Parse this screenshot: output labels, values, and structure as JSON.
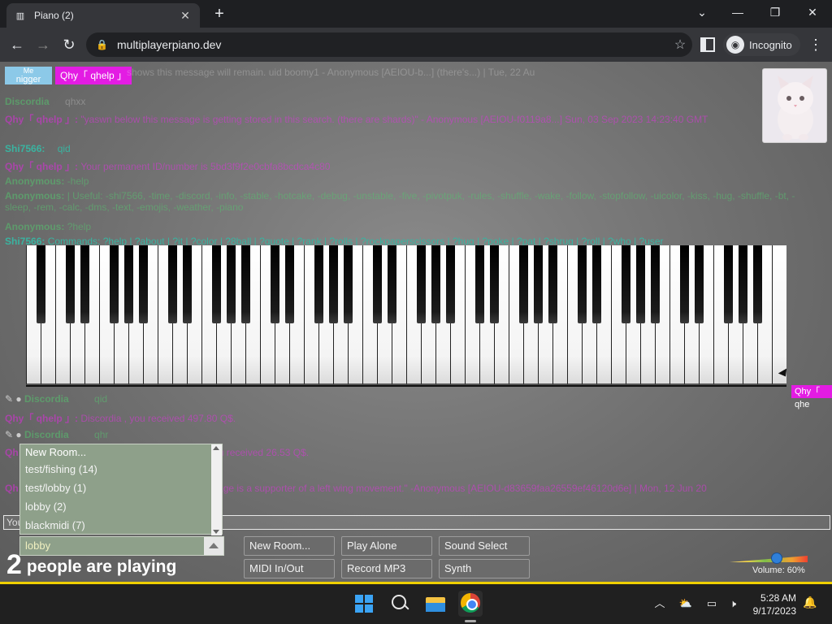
{
  "browser": {
    "tab_title": "Piano (2)",
    "tab_close": "✕",
    "new_tab": "+",
    "url": "multiplayerpiano.dev",
    "incognito_label": "Incognito",
    "window_minimize": "—",
    "window_restore": "❐",
    "window_close": "✕",
    "dropdown": "⌄"
  },
  "users": {
    "me_label": "Me",
    "me_name": "nigger",
    "other": "Qhy「 qhelp 」"
  },
  "chat": {
    "lines": [
      {
        "name": "",
        "text": "shows this message will remain. uid boomy1 - Anonymous [AEIOU-b...] (there's...)  | Tue, 22 Au",
        "name_class": "",
        "text_class": "faded"
      },
      {
        "name": "Discordia",
        "text": "qhxx",
        "name_class": "n-green",
        "text_class": "faded"
      },
      {
        "name": "Qhy「 qhelp 」:",
        "text": "\"yaswn below this message is getting stored in this search. (there are shards)\" - Anonymous [AEIOU-f0119a8...] Sun, 03 Sep 2023 14:23:40 GMT",
        "name_class": "n-pink",
        "text_class": "t-pink faded"
      },
      {
        "name": "Shi7566:",
        "text": "qid",
        "name_class": "n-teal",
        "text_class": "t-teal"
      },
      {
        "name": "Qhy「 qhelp 」:",
        "text": "Your permanent ID/number is 5bd3f9f2e0cbfa8bcdca4c80",
        "name_class": "n-pink",
        "text_class": "t-pink faded"
      },
      {
        "name": "Anonymous:",
        "text": "-help",
        "name_class": "n-green",
        "text_class": "t-green faded"
      },
      {
        "name": "Anonymous:",
        "text": "| Useful: -shi7566, -time, -discord, -info, -stable, -hotcake, -debug, -unstable, -five, -pivotpuk, -rules, -shuffle, -wake, -follow, -stopfollow, -uicolor, -kiss, -hug, -shuffle, -bt, -sleep, -rem, -calc, -dms, -text, -emojis, -weather, -piano",
        "name_class": "n-green",
        "text_class": "t-green faded"
      },
      {
        "name": "Anonymous:",
        "text": "?help",
        "name_class": "n-green",
        "text_class": "t-green faded"
      },
      {
        "name": "Shi7566:",
        "text": "Commands: ?help | ?about | ?it | ?color | ?8ball | ?quote | ?rank | ?rolls | ?rockpaperscissors | ?hug | ?poke | ?pat | ?shrug | ?roll | ?who | ?user",
        "name_class": "n-teal",
        "text_class": "t-teal"
      }
    ],
    "lower_lines": [
      {
        "name": "Discordia",
        "text": "qid",
        "name_class": "n-green",
        "text_class": "t-green faded"
      },
      {
        "name": "Qhy「 qhelp 」:",
        "text": "Discordia , you received 497.80 Q$.",
        "name_class": "n-pink",
        "text_class": "t-pink faded"
      },
      {
        "name": "Discordia",
        "text": "qhr",
        "name_class": "n-green",
        "text_class": "t-green faded"
      },
      {
        "name": "Qh",
        "text": "you received 26.53 Q$.",
        "name_class": "n-pink",
        "text_class": "t-pink faded"
      },
      {
        "name": "Qh",
        "text": "ssage is a supporter of a left wing movement.\" -Anonymous [AEIOU-d83659faa26559ef46120d6e] | Mon, 12 Jun 20",
        "name_class": "n-pink",
        "text_class": "t-pink faded"
      }
    ],
    "input_prefix": "You"
  },
  "cursor_tag": "Qhy「 qhe",
  "rooms": {
    "items": [
      "New Room...",
      "test/fishing (14)",
      "test/lobby (1)",
      "lobby (2)",
      "blackmidi (7)"
    ],
    "selected": "lobby"
  },
  "players": {
    "count": "2",
    "label": "people are playing"
  },
  "buttons": {
    "new_room": "New Room...",
    "play_alone": "Play Alone",
    "sound_select": "Sound Select",
    "midi": "MIDI In/Out",
    "record": "Record MP3",
    "synth": "Synth"
  },
  "volume": {
    "label": "Volume: 60%",
    "value": 60
  },
  "taskbar": {
    "time": "5:28 AM",
    "date": "9/17/2023",
    "tray_chevron": "︿",
    "tray_net": "⛅",
    "tray_screen": "▭",
    "tray_volume": "🕨"
  }
}
